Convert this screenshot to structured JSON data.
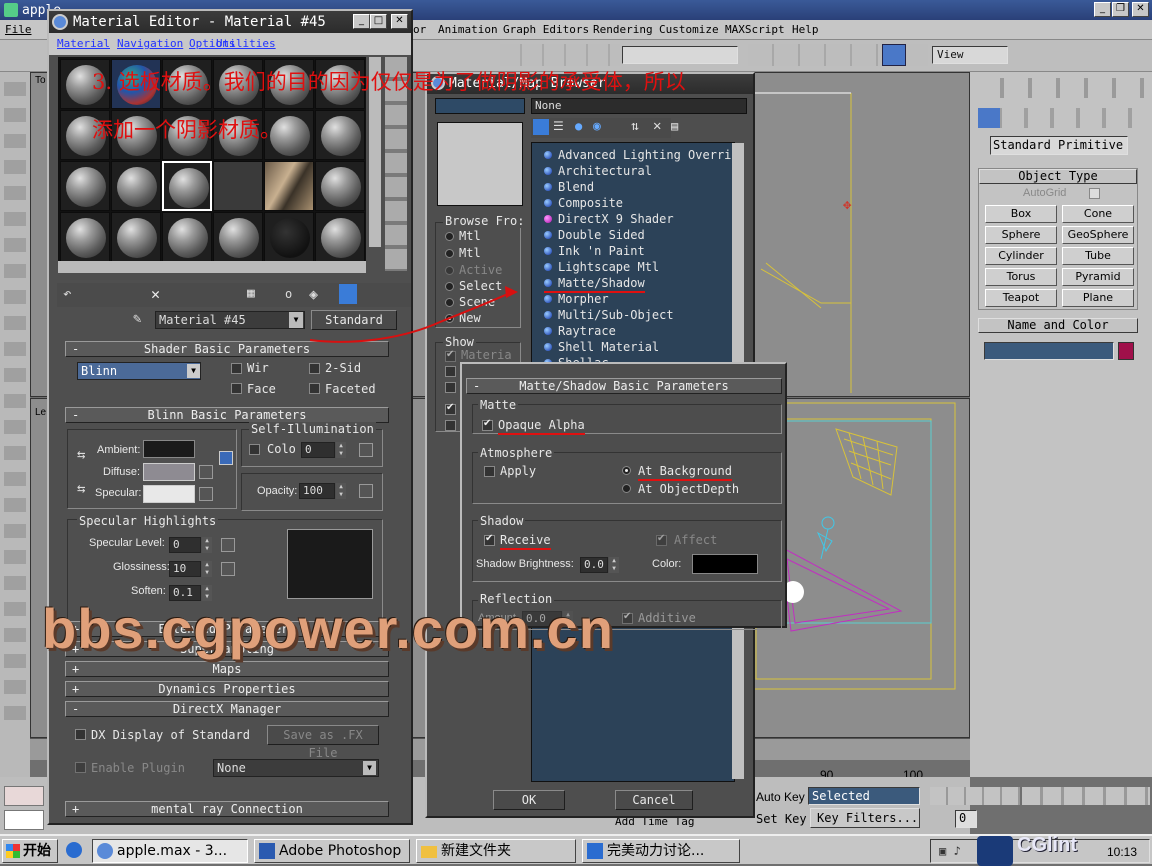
{
  "app": {
    "title": "apple",
    "menu": [
      "File",
      "Animation",
      "Graph Editors",
      "Rendering",
      "Customize",
      "MAXScript",
      "Help"
    ],
    "menu_partial": "or",
    "viewport_label": "View",
    "viewport_tl": "To",
    "viewport_bl": "Le",
    "timeline_ticks": [
      "90",
      "100"
    ]
  },
  "command_panel": {
    "dropdown": "Standard Primitive",
    "object_type_title": "Object Type",
    "autogrid": "AutoGrid",
    "primitives": [
      "Box",
      "Cone",
      "Sphere",
      "GeoSphere",
      "Cylinder",
      "Tube",
      "Torus",
      "Pyramid",
      "Teapot",
      "Plane"
    ],
    "name_color_title": "Name and Color"
  },
  "bottom_bar": {
    "auto_key": "Auto Key",
    "selected": "Selected",
    "set_key": "Set Key",
    "key_filters": "Key Filters...",
    "add_time_tag": "Add Time Tag",
    "frame": "0",
    "clock": "10:13"
  },
  "material_editor": {
    "title": "Material Editor - Material #45",
    "menu": [
      "Material",
      "Navigation",
      "Options",
      "Utilities"
    ],
    "material_name": "Material #45",
    "type_button": "Standard",
    "shader_rollout": "Shader Basic Parameters",
    "shader_type": "Blinn",
    "wire": "Wir",
    "two_sided": "2-Sid",
    "face": "Face",
    "faceted": "Faceted",
    "blinn_rollout": "Blinn Basic Parameters",
    "self_illum": "Self-Illumination",
    "color": "Colo",
    "self_illum_value": "0",
    "ambient": "Ambient:",
    "diffuse": "Diffuse:",
    "specular": "Specular:",
    "opacity": "Opacity:",
    "opacity_value": "100",
    "spec_highlights": "Specular Highlights",
    "spec_level": "Specular Level:",
    "spec_level_value": "0",
    "glossiness": "Glossiness:",
    "glossiness_value": "10",
    "soften": "Soften:",
    "soften_value": "0.1",
    "extended_partial": "Extended Parame ers",
    "supersampling": "SuperSampling",
    "maps": "Maps",
    "dynamics": "Dynamics Properties",
    "directx": "DirectX Manager",
    "dx_display": "DX Display of Standard",
    "save_fx": "Save as .FX File",
    "enable_plugin": "Enable Plugin",
    "none": "None",
    "mental_ray": "mental ray Connection",
    "icon_label_o": "o"
  },
  "map_browser": {
    "title": "Material/Map Browser",
    "name_field": "None",
    "browse_from": "Browse Fro:",
    "browse_options": [
      "Mtl",
      "Mtl",
      "Active",
      "Select",
      "Scene",
      "New"
    ],
    "show": "Show",
    "show_options": [
      "Materia"
    ],
    "items": [
      "Advanced Lighting Overrid",
      "Architectural",
      "Blend",
      "Composite",
      "DirectX 9 Shader",
      "Double Sided",
      "Ink 'n Paint",
      "Lightscape Mtl",
      "Matte/Shadow",
      "Morpher",
      "Multi/Sub-Object",
      "Raytrace",
      "Shell Material",
      "Shellac"
    ],
    "ok": "OK",
    "cancel": "Cancel"
  },
  "matte_shadow": {
    "title": "Matte/Shadow Basic Parameters",
    "matte": "Matte",
    "opaque_alpha": "Opaque Alpha",
    "atmosphere": "Atmosphere",
    "apply": "Apply",
    "at_background": "At Background",
    "at_objectdepth": "At ObjectDepth",
    "shadow": "Shadow",
    "receive": "Receive",
    "affect": "Affect",
    "shadow_brightness": "Shadow Brightness:",
    "shadow_brightness_value": "0.0",
    "color": "Color:",
    "reflection": "Reflection",
    "amount": "Amount",
    "amount_value": "0.0",
    "additive": "Additive"
  },
  "annotations": {
    "line1": "3. 选板材质。我们的目的因为仅仅是为了做阴影的承受体，所以",
    "line2": "添加一个阴影材质。",
    "watermark": "bbs.cgpower.com.cn",
    "logo": "CGlint"
  },
  "taskbar": {
    "start": "开始",
    "tasks": [
      "apple.max - 3...",
      "Adobe Photoshop",
      "新建文件夹",
      "完美动力讨论..."
    ]
  }
}
